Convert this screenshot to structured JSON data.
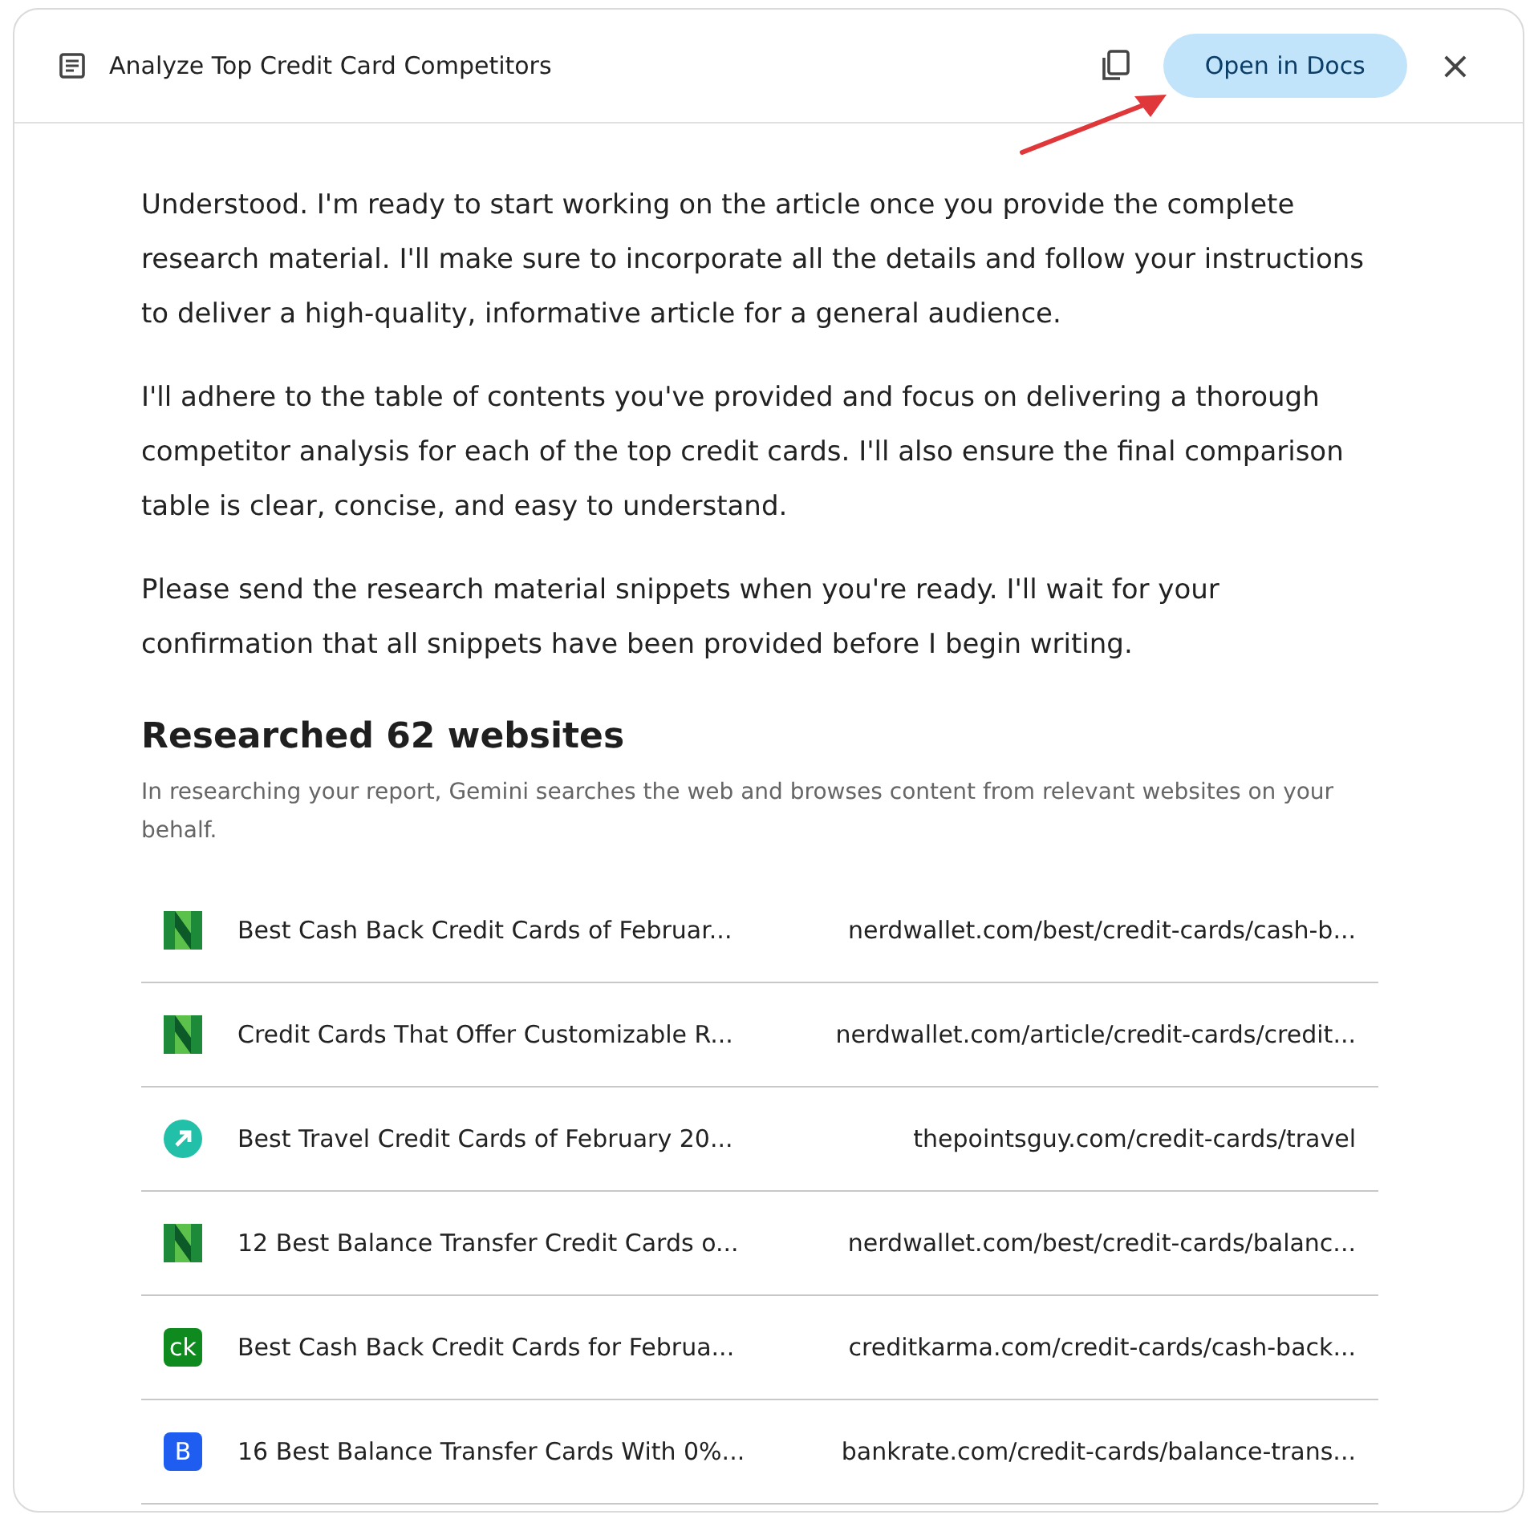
{
  "header": {
    "title": "Analyze Top Credit Card Competitors",
    "open_button": "Open in Docs",
    "close": "×"
  },
  "paragraphs": [
    "Understood. I'm ready to start working on the article once you provide the complete research material. I'll make sure to incorporate all the details and follow your instructions to deliver a high-quality, informative article for a general audience.",
    "I'll adhere to the table of contents you've provided and focus on delivering a thorough competitor analysis for each of the top credit cards. I'll also ensure the final comparison table is clear, concise, and easy to understand.",
    "Please send the research material snippets when you're ready. I'll wait for your confirmation that all snippets have been provided before I begin writing."
  ],
  "research": {
    "heading": "Researched 62 websites",
    "note": "In researching your report, Gemini searches the web and browses content from relevant websites on your behalf.",
    "sites": [
      {
        "kind": "n",
        "title": "Best Cash Back Credit Cards of Februar...",
        "url": "nerdwallet.com/best/credit-cards/cash-b..."
      },
      {
        "kind": "n",
        "title": "Credit Cards That Offer Customizable R...",
        "url": "nerdwallet.com/article/credit-cards/credit..."
      },
      {
        "kind": "arrow",
        "title": "Best Travel Credit Cards of February 20...",
        "url": "thepointsguy.com/credit-cards/travel"
      },
      {
        "kind": "n",
        "title": "12 Best Balance Transfer Credit Cards o...",
        "url": "nerdwallet.com/best/credit-cards/balanc..."
      },
      {
        "kind": "letter",
        "icon_text": "ck",
        "color": "#0f8a1f",
        "title": "Best Cash Back Credit Cards for Februa...",
        "url": "creditkarma.com/credit-cards/cash-back..."
      },
      {
        "kind": "letter",
        "icon_text": "B",
        "color": "#1f5cf0",
        "title": "16 Best Balance Transfer Cards With 0%...",
        "url": "bankrate.com/credit-cards/balance-trans..."
      }
    ]
  }
}
